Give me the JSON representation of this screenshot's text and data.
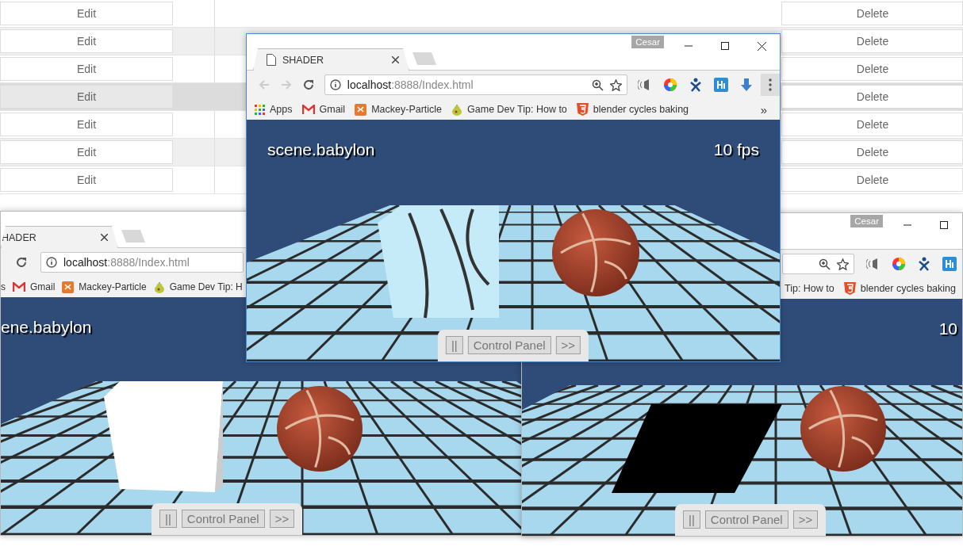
{
  "background_table": {
    "rows": [
      {
        "action_1": "Edit",
        "action_2": "Delete",
        "highlighted": false
      },
      {
        "action_1": "Edit",
        "action_2": "Delete",
        "highlighted": false
      },
      {
        "action_1": "Edit",
        "action_2": "Delete",
        "highlighted": false
      },
      {
        "action_1": "Edit",
        "action_2": "Delete",
        "highlighted": true
      },
      {
        "action_1": "Edit",
        "action_2": "Delete",
        "highlighted": false
      },
      {
        "action_1": "Edit",
        "action_2": "Delete",
        "highlighted": false
      },
      {
        "action_1": "Edit",
        "action_2": "Delete",
        "highlighted": false
      }
    ]
  },
  "windows": [
    {
      "tab": {
        "title": "HADER"
      },
      "address": {
        "host": "localhost",
        "path": ":8888/Index.html"
      },
      "bookmarks": [
        {
          "kind": "plain",
          "label": "s"
        },
        {
          "kind": "gmail",
          "label": "Gmail"
        },
        {
          "kind": "square-logo",
          "label": "Mackey-Particle"
        },
        {
          "kind": "pear",
          "label": "Game Dev Tip: H"
        }
      ],
      "scene": {
        "title": "ene.babylon",
        "objects": [
          {
            "kind": "white-cube"
          },
          {
            "kind": "ball"
          }
        ]
      },
      "control_panel": {
        "buttons": [
          "||",
          "Control Panel",
          ">>"
        ]
      }
    },
    {
      "user": "Cesar",
      "bookmarks": [
        {
          "kind": "plain",
          "label": "Tip: How to"
        },
        {
          "kind": "html5",
          "label": "blender cycles baking"
        }
      ],
      "scene": {
        "fps": "10",
        "objects": [
          {
            "kind": "black-plane"
          },
          {
            "kind": "ball"
          }
        ]
      },
      "control_panel": {
        "buttons": [
          "||",
          "Control Panel",
          ">>"
        ]
      }
    },
    {
      "user": "Cesar",
      "tab": {
        "title": "SHADER"
      },
      "address": {
        "host": "localhost",
        "path": ":8888/Index.html"
      },
      "bookmarks": [
        {
          "kind": "apps",
          "label": "Apps"
        },
        {
          "kind": "gmail",
          "label": "Gmail"
        },
        {
          "kind": "square-logo",
          "label": "Mackey-Particle"
        },
        {
          "kind": "pear",
          "label": "Game Dev Tip: How to"
        },
        {
          "kind": "html5",
          "label": "blender cycles baking"
        }
      ],
      "bookmarks_more": "»",
      "scene": {
        "title": "scene.babylon",
        "fps": "10 fps",
        "objects": [
          {
            "kind": "textured-cube"
          },
          {
            "kind": "ball"
          }
        ]
      },
      "control_panel": {
        "buttons": [
          "||",
          "Control Panel",
          ">>"
        ]
      }
    }
  ]
}
